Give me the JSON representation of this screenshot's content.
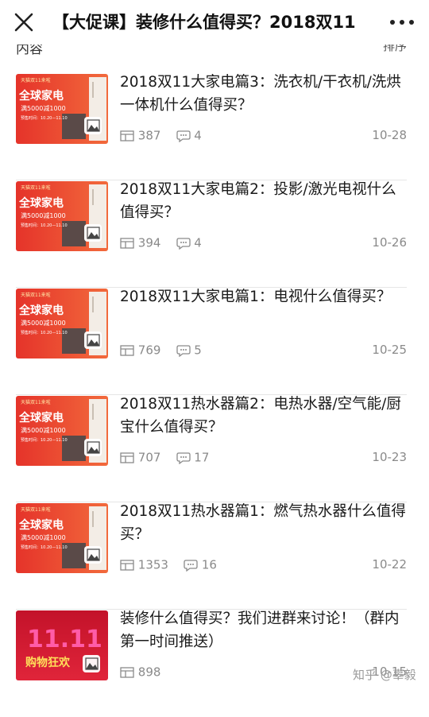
{
  "topbar": {
    "title": "【大促课】装修什么值得买？2018双11",
    "close_icon": "close-icon",
    "more_icon": "more-icon"
  },
  "peek": {
    "left": "内容",
    "right": "排序"
  },
  "articles": [
    {
      "title": "2018双11大家电篇3：洗衣机/干衣机/洗烘一体机什么值得买？",
      "views": "387",
      "comments": "4",
      "date": "10-28",
      "thumb": "appliance-banner"
    },
    {
      "title": "2018双11大家电篇2：投影/激光电视什么值得买？",
      "views": "394",
      "comments": "4",
      "date": "10-26",
      "thumb": "appliance-banner"
    },
    {
      "title": "2018双11大家电篇1：电视什么值得买？",
      "views": "769",
      "comments": "5",
      "date": "10-25",
      "thumb": "appliance-banner"
    },
    {
      "title": "2018双11热水器篇2：电热水器/空气能/厨宝什么值得买？",
      "views": "707",
      "comments": "17",
      "date": "10-23",
      "thumb": "appliance-banner"
    },
    {
      "title": "2018双11热水器篇1：燃气热水器什么值得买？",
      "views": "1353",
      "comments": "16",
      "date": "10-22",
      "thumb": "appliance-banner"
    },
    {
      "title": "装修什么值得买？我们进群来讨论！（群内第一时间推送）",
      "views": "898",
      "comments": "",
      "date": "10-15",
      "thumb": "double11-banner"
    }
  ],
  "banner": {
    "brand": "天猫双11来啦",
    "headline": "全球家电",
    "promo": "满5000减1000",
    "period": "预售时间：10.20—11.10",
    "d11_text": "11.11",
    "d11_sub": "购物狂欢"
  },
  "watermark": "知乎 @辜毅",
  "colors": {
    "accent": "#e5332a",
    "meta": "#8a8a8a",
    "divider": "#e6e6e6"
  }
}
